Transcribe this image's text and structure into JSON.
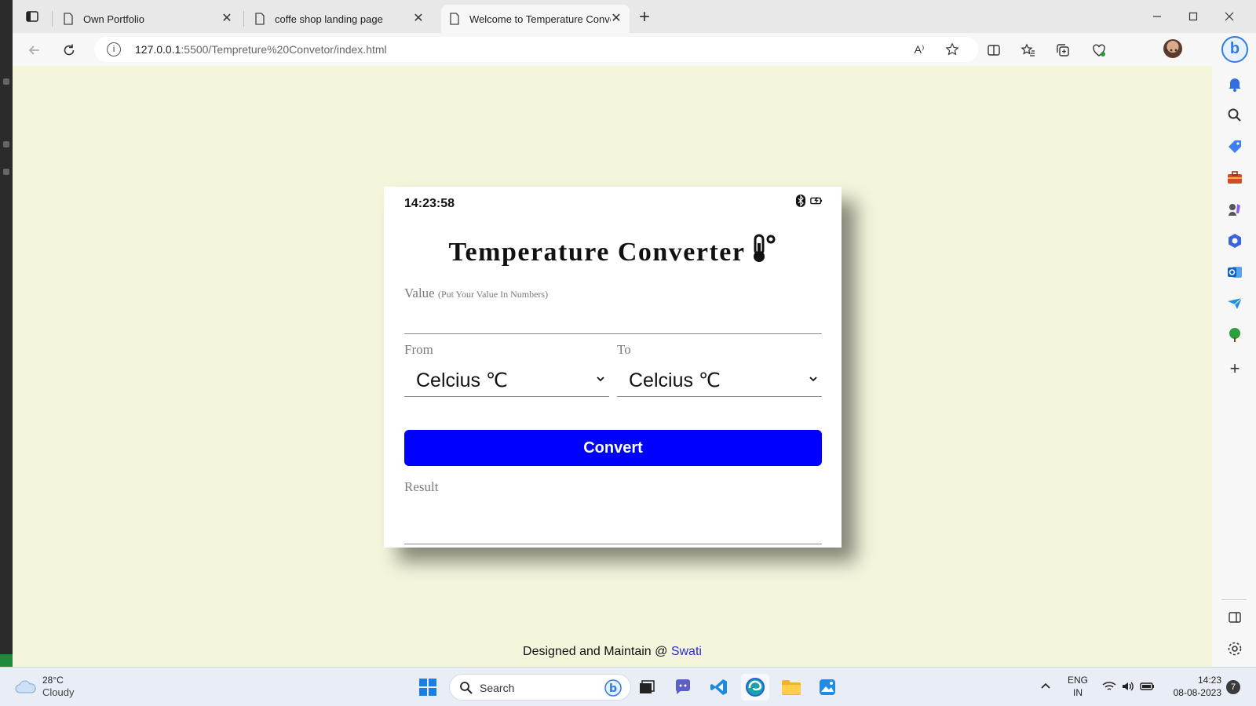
{
  "browser": {
    "tabs": [
      {
        "title": "Own Portfolio"
      },
      {
        "title": "coffe shop landing page"
      },
      {
        "title": "Welcome to Temperature Conver"
      }
    ],
    "url_host": "127.0.0.1",
    "url_path": ":5500/Tempreture%20Convetor/index.html",
    "info_glyph": "i",
    "read_aloud": "A⁾"
  },
  "app": {
    "clock": "14:23:58",
    "title": "Temperature Converter",
    "value_label": "Value",
    "value_hint": "(Put Your Value In Numbers)",
    "value_input": "",
    "from_label": "From",
    "to_label": "To",
    "from_selected": "Celcius ℃",
    "to_selected": "Celcius ℃",
    "convert_label": "Convert",
    "result_label": "Result",
    "result_value": ""
  },
  "footer": {
    "text": "Designed and Maintain @ ",
    "author": "Swati"
  },
  "taskbar": {
    "weather_temp": "28°C",
    "weather_desc": "Cloudy",
    "search_label": "Search",
    "lang_line1": "ENG",
    "lang_line2": "IN",
    "time": "14:23",
    "date": "08-08-2023",
    "notification_count": "7"
  },
  "colors": {
    "page_bg": "#f5f5dc",
    "convert_bg": "#0000ff",
    "footer_link": "#2b2bd8"
  }
}
